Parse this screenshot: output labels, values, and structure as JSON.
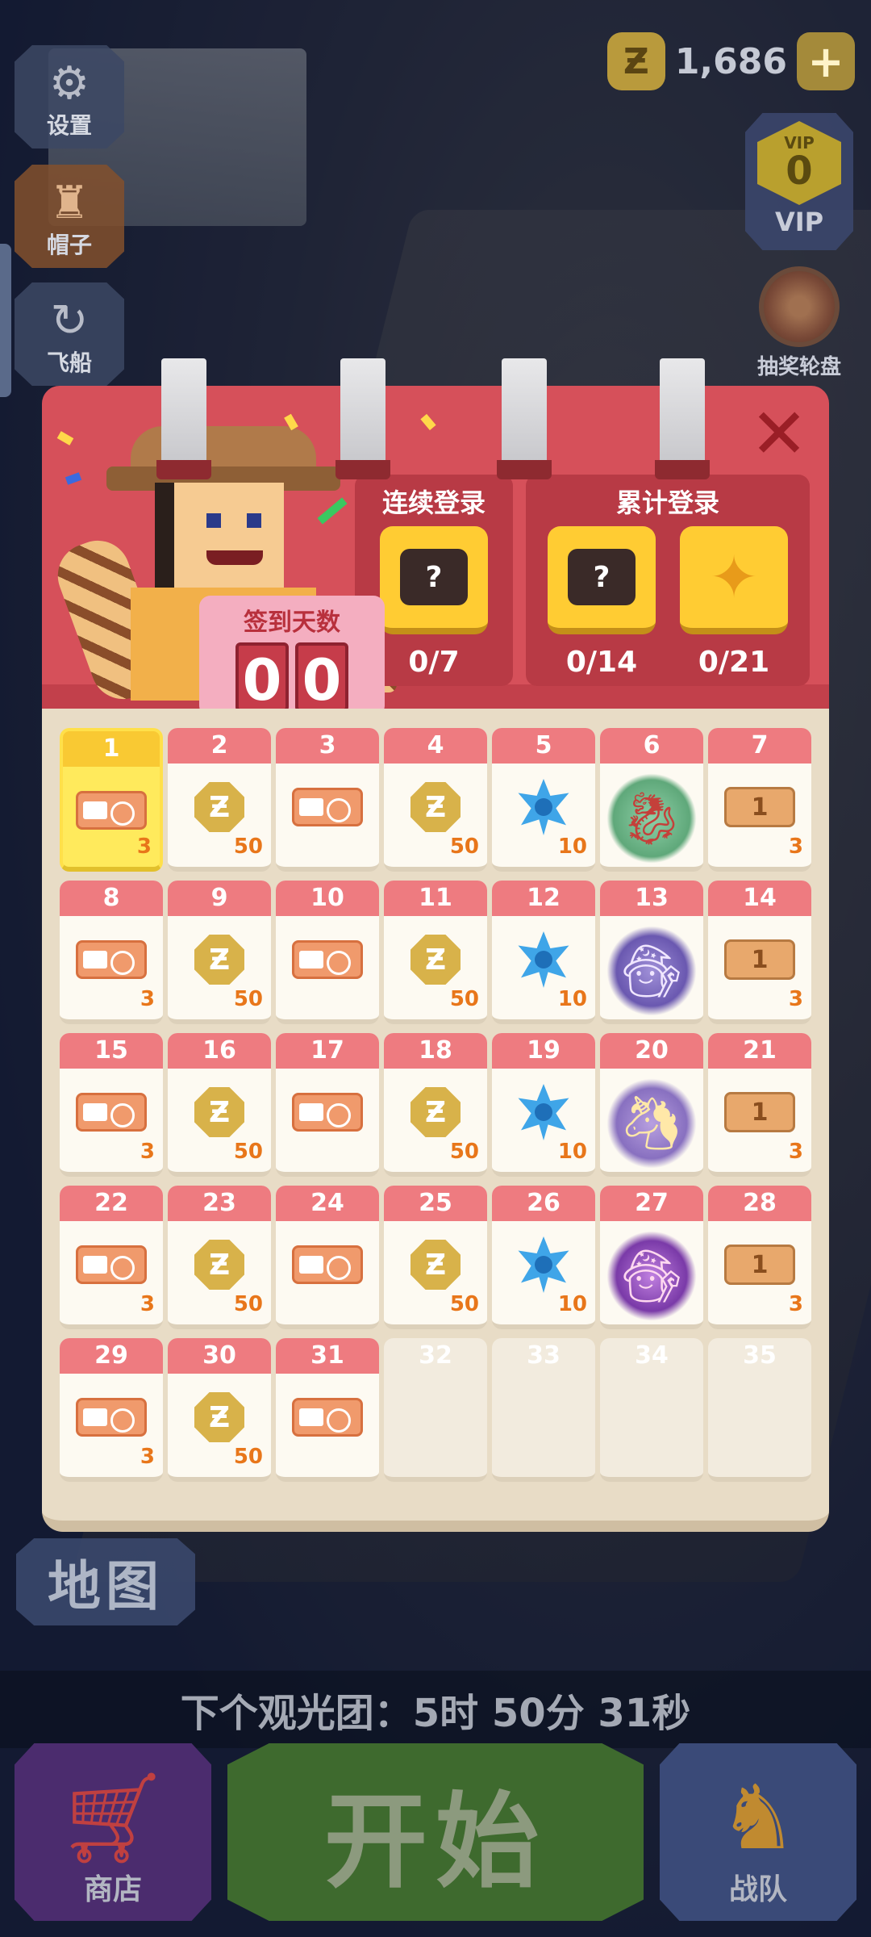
{
  "top_bar": {
    "coin_symbol": "Ƶ",
    "coin_amount": "1,686",
    "plus_symbol": "+",
    "vip_small": "VIP",
    "vip_level": "0",
    "vip_label": "VIP",
    "lottery_label": "抽奖轮盘"
  },
  "side_menu": [
    {
      "label": "设置",
      "icon": "gear-icon"
    },
    {
      "label": "帽子",
      "icon": "hat-icon"
    },
    {
      "label": "飞船",
      "icon": "spaceship-icon"
    }
  ],
  "calendar": {
    "close_symbol": "✕",
    "counter_title": "签到天数",
    "counter_digits": [
      "0",
      "0"
    ],
    "consecutive": {
      "title": "连续登录",
      "rewards": [
        {
          "icon": "mystery-silhouette-icon",
          "mark": "?",
          "progress": "0/7"
        }
      ]
    },
    "cumulative": {
      "title": "累计登录",
      "rewards": [
        {
          "icon": "mystery-silhouette-icon",
          "mark": "?",
          "progress": "0/14"
        },
        {
          "icon": "golden-dragon-icon",
          "mark": "",
          "progress": "0/21"
        }
      ]
    },
    "days": [
      {
        "day": "1",
        "reward": "ticket",
        "qty": "3",
        "state": "today"
      },
      {
        "day": "2",
        "reward": "coin",
        "qty": "50"
      },
      {
        "day": "3",
        "reward": "ticket",
        "qty": ""
      },
      {
        "day": "4",
        "reward": "coin",
        "qty": "50"
      },
      {
        "day": "5",
        "reward": "star",
        "qty": "10"
      },
      {
        "day": "6",
        "reward": "pet-dragons",
        "qty": ""
      },
      {
        "day": "7",
        "reward": "vip-ticket",
        "qty": "3"
      },
      {
        "day": "8",
        "reward": "ticket",
        "qty": "3"
      },
      {
        "day": "9",
        "reward": "coin",
        "qty": "50"
      },
      {
        "day": "10",
        "reward": "ticket",
        "qty": ""
      },
      {
        "day": "11",
        "reward": "coin",
        "qty": "50"
      },
      {
        "day": "12",
        "reward": "star",
        "qty": "10"
      },
      {
        "day": "13",
        "reward": "pet-wizard",
        "qty": ""
      },
      {
        "day": "14",
        "reward": "vip-ticket",
        "qty": "3"
      },
      {
        "day": "15",
        "reward": "ticket",
        "qty": "3"
      },
      {
        "day": "16",
        "reward": "coin",
        "qty": "50"
      },
      {
        "day": "17",
        "reward": "ticket",
        "qty": ""
      },
      {
        "day": "18",
        "reward": "coin",
        "qty": "50"
      },
      {
        "day": "19",
        "reward": "star",
        "qty": "10"
      },
      {
        "day": "20",
        "reward": "pet-creature",
        "qty": ""
      },
      {
        "day": "21",
        "reward": "vip-ticket",
        "qty": "3"
      },
      {
        "day": "22",
        "reward": "ticket",
        "qty": "3"
      },
      {
        "day": "23",
        "reward": "coin",
        "qty": "50"
      },
      {
        "day": "24",
        "reward": "ticket",
        "qty": ""
      },
      {
        "day": "25",
        "reward": "coin",
        "qty": "50"
      },
      {
        "day": "26",
        "reward": "star",
        "qty": "10"
      },
      {
        "day": "27",
        "reward": "pet-witch",
        "qty": ""
      },
      {
        "day": "28",
        "reward": "vip-ticket",
        "qty": "3"
      },
      {
        "day": "29",
        "reward": "ticket",
        "qty": "3"
      },
      {
        "day": "30",
        "reward": "coin",
        "qty": "50"
      },
      {
        "day": "31",
        "reward": "ticket",
        "qty": ""
      },
      {
        "day": "32",
        "reward": "none",
        "qty": "",
        "state": "empty"
      },
      {
        "day": "33",
        "reward": "none",
        "qty": "",
        "state": "empty"
      },
      {
        "day": "34",
        "reward": "none",
        "qty": "",
        "state": "empty"
      },
      {
        "day": "35",
        "reward": "none",
        "qty": "",
        "state": "empty"
      }
    ],
    "coin_glyph": "Ƶ",
    "vip_ticket_glyph": "1"
  },
  "bottom": {
    "map_label": "地图",
    "tour_text": "下个观光团：5时 50分 31秒",
    "shop_label": "商店",
    "start_label": "开始",
    "team_label": "战队"
  }
}
